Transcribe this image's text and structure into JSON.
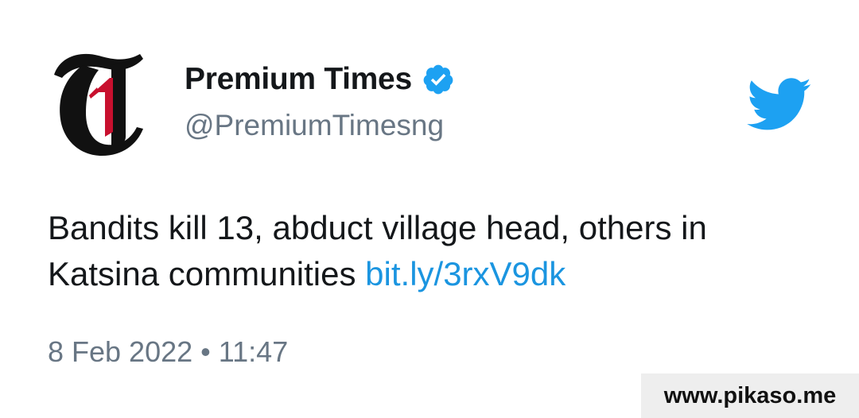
{
  "author": {
    "display_name": "Premium Times",
    "handle": "@PremiumTimesng",
    "verified": true,
    "avatar_icon": "premium-times-logo",
    "brand_colors": {
      "logo_black": "#111111",
      "logo_red": "#c8102e"
    }
  },
  "tweet": {
    "text": "Bandits kill 13, abduct village head, others in Katsina communities",
    "link": "bit.ly/3rxV9dk",
    "date": "8 Feb 2022",
    "separator": "•",
    "time": "11:47"
  },
  "platform_icon": "twitter-bird-icon",
  "colors": {
    "text": "#14171a",
    "secondary": "#687684",
    "link": "#1b95e0",
    "verified": "#1da1f2",
    "twitter_blue": "#1da1f2",
    "watermark_bg": "#eeeeee"
  },
  "watermark": {
    "text": "www.pikaso.me"
  }
}
